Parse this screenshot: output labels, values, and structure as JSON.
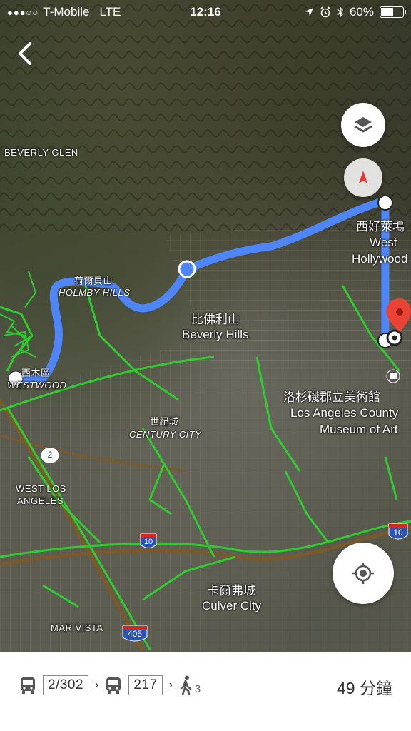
{
  "status_bar": {
    "signal": "●●●○○",
    "carrier": "T-Mobile",
    "network": "LTE",
    "time": "12:16",
    "battery": "60%",
    "battery_level": 0.6
  },
  "map": {
    "labels": {
      "beverly_glen": "BEVERLY GLEN",
      "holmby_hills_zh": "荷爾貝山",
      "holmby_hills": "HOLMBY HILLS",
      "westwood_zh": "西木區",
      "westwood": "WESTWOOD",
      "beverly_hills_zh": "比佛利山",
      "beverly_hills": "Beverly Hills",
      "west_hollywood_zh": "西好萊塢",
      "west_hollywood_1": "West",
      "west_hollywood_2": "Hollywood",
      "lacma_zh": "洛杉磯郡立美術館",
      "lacma_1": "Los Angeles County",
      "lacma_2": "Museum of Art",
      "century_city_zh": "世紀城",
      "century_city": "CENTURY CITY",
      "west_la_1": "WEST LOS",
      "west_la_2": "ANGELES",
      "culver_city_zh": "卡爾弗城",
      "culver_city": "Culver City",
      "mar_vista": "MAR VISTA"
    },
    "shields": {
      "route_2": "2",
      "i10_a": "10",
      "i10_b": "10",
      "i405": "405"
    },
    "route_color": "#4f86f7",
    "traffic_color": "#2ecc2e"
  },
  "controls": {
    "back_icon": "chevron-left-icon",
    "layers_icon": "layers-icon",
    "compass_icon": "compass-icon",
    "locate_icon": "my-location-icon"
  },
  "directions": {
    "bus1": "2/302",
    "bus2": "217",
    "walk_count": "3",
    "duration": "49 分鐘"
  }
}
